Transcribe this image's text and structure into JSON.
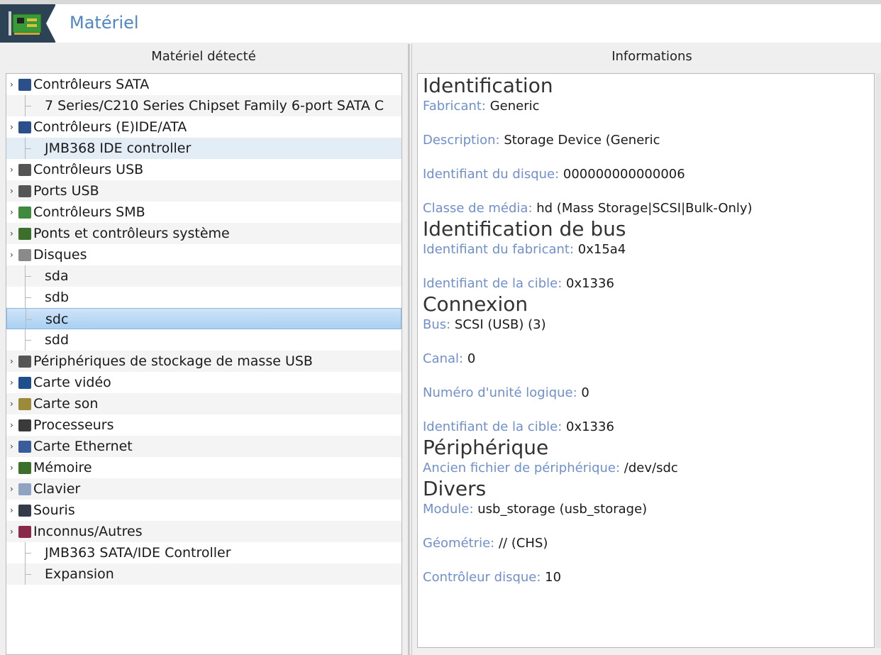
{
  "header": {
    "title": "Matériel"
  },
  "left_pane": {
    "title": "Matériel détecté"
  },
  "right_pane": {
    "title": "Informations"
  },
  "tree": [
    {
      "type": "category",
      "label": "Contrôleurs SATA",
      "icon": "sata-controller-icon",
      "color": "#2a4f8a"
    },
    {
      "type": "child",
      "label": "7 Series/C210 Series Chipset Family 6-port SATA C"
    },
    {
      "type": "category",
      "label": "Contrôleurs (E)IDE/ATA",
      "icon": "ide-controller-icon",
      "color": "#2a4f8a"
    },
    {
      "type": "child",
      "label": "JMB368 IDE controller"
    },
    {
      "type": "category",
      "label": "Contrôleurs USB",
      "icon": "usb-icon",
      "color": "#555555"
    },
    {
      "type": "category",
      "label": "Ports USB",
      "icon": "usb-icon",
      "color": "#555555"
    },
    {
      "type": "category",
      "label": "Contrôleurs SMB",
      "icon": "smb-controller-icon",
      "color": "#3f8a3f"
    },
    {
      "type": "category",
      "label": "Ponts et contrôleurs système",
      "icon": "bridge-icon",
      "color": "#3c6e2c"
    },
    {
      "type": "category",
      "label": "Disques",
      "icon": "disk-icon",
      "color": "#8a8a8a"
    },
    {
      "type": "child",
      "label": "sda"
    },
    {
      "type": "child",
      "label": "sdb"
    },
    {
      "type": "child",
      "label": "sdc"
    },
    {
      "type": "child",
      "label": "sdd"
    },
    {
      "type": "category",
      "label": "Périphériques de stockage de masse USB",
      "icon": "usb-storage-icon",
      "color": "#555555"
    },
    {
      "type": "category",
      "label": "Carte vidéo",
      "icon": "video-card-icon",
      "color": "#1f4e8c"
    },
    {
      "type": "category",
      "label": "Carte son",
      "icon": "sound-card-icon",
      "color": "#9b8a3a"
    },
    {
      "type": "category",
      "label": "Processeurs",
      "icon": "cpu-icon",
      "color": "#3a3a3a"
    },
    {
      "type": "category",
      "label": "Carte Ethernet",
      "icon": "ethernet-icon",
      "color": "#3a5c9a"
    },
    {
      "type": "category",
      "label": "Mémoire",
      "icon": "memory-icon",
      "color": "#3c6e2c"
    },
    {
      "type": "category",
      "label": "Clavier",
      "icon": "keyboard-icon",
      "color": "#8ea4c0"
    },
    {
      "type": "category",
      "label": "Souris",
      "icon": "mouse-icon",
      "color": "#333a4a"
    },
    {
      "type": "category",
      "label": "Inconnus/Autres",
      "icon": "unknown-device-icon",
      "color": "#8a2a4a"
    },
    {
      "type": "child",
      "label": "JMB363 SATA/IDE Controller"
    },
    {
      "type": "child",
      "label": "Expansion"
    }
  ],
  "info": [
    {
      "title": "Identification",
      "fields": [
        {
          "label": "Fabricant:",
          "value": "Generic"
        },
        {
          "label": "Description:",
          "value": "Storage Device (Generic"
        },
        {
          "label": "Identifiant du disque:",
          "value": "000000000000006"
        },
        {
          "label": "Classe de média:",
          "value": "hd (Mass Storage|SCSI|Bulk-Only)"
        }
      ]
    },
    {
      "title": "Identification de bus",
      "fields": [
        {
          "label": "Identifiant du fabricant:",
          "value": "0x15a4"
        },
        {
          "label": "Identifiant de la cible:",
          "value": "0x1336"
        }
      ]
    },
    {
      "title": "Connexion",
      "fields": [
        {
          "label": "Bus:",
          "value": "SCSI (USB) (3)"
        },
        {
          "label": "Canal:",
          "value": "0"
        },
        {
          "label": "Numéro d'unité logique:",
          "value": "0"
        },
        {
          "label": "Identifiant de la cible:",
          "value": "0x1336"
        }
      ]
    },
    {
      "title": "Périphérique",
      "fields": [
        {
          "label": "Ancien fichier de périphérique:",
          "value": "/dev/sdc"
        }
      ]
    },
    {
      "title": "Divers",
      "fields": [
        {
          "label": "Module:",
          "value": "usb_storage (usb_storage)"
        },
        {
          "label": "Géométrie:",
          "value": "// (CHS)"
        },
        {
          "label": "Contrôleur disque:",
          "value": "10"
        }
      ]
    }
  ]
}
